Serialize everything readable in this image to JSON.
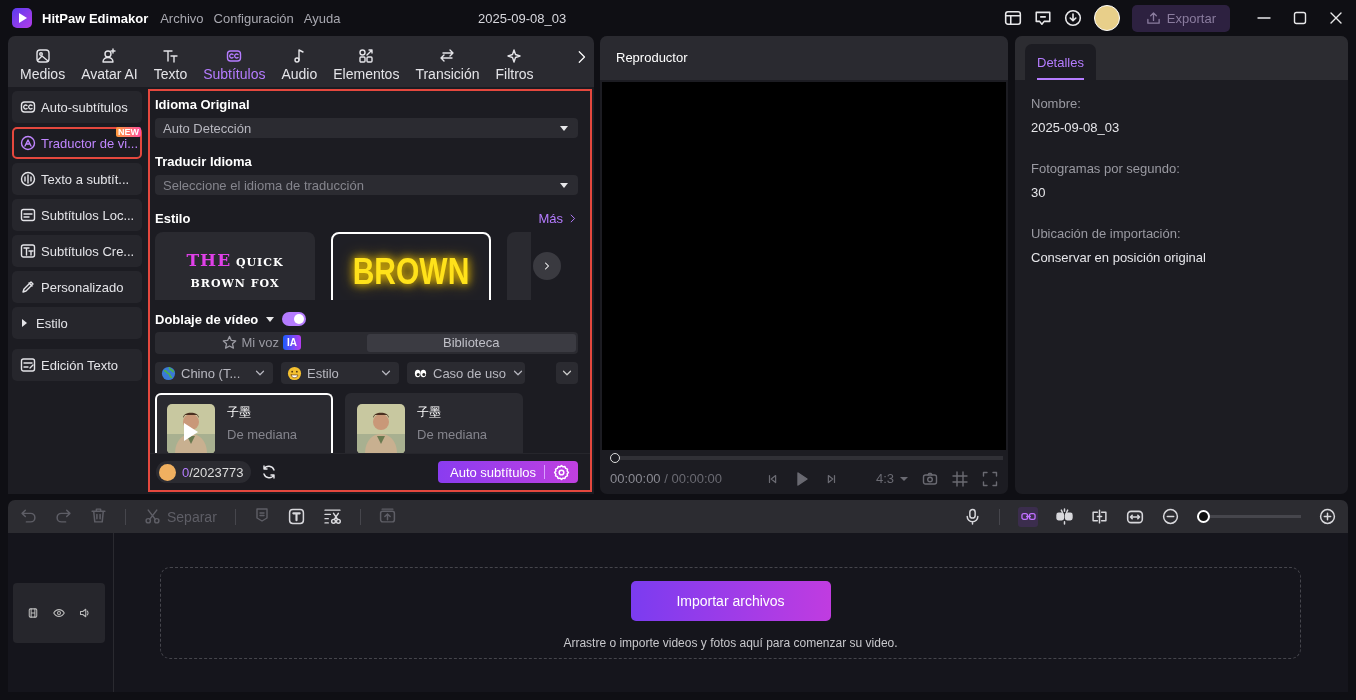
{
  "app": {
    "name": "HitPaw Edimakor",
    "menu": [
      "Archivo",
      "Configuración",
      "Ayuda"
    ],
    "document_title": "2025-09-08_03",
    "export_button": "Exportar"
  },
  "media_tabs": [
    {
      "label": "Medios",
      "selected": false
    },
    {
      "label": "Avatar AI",
      "selected": false
    },
    {
      "label": "Texto",
      "selected": false
    },
    {
      "label": "Subtítulos",
      "selected": true
    },
    {
      "label": "Audio",
      "selected": false
    },
    {
      "label": "Elementos",
      "selected": false
    },
    {
      "label": "Transición",
      "selected": false
    },
    {
      "label": "Filtros",
      "selected": false
    }
  ],
  "sidebar": {
    "items": [
      {
        "label": "Auto-subtítulos",
        "kind": "item",
        "selected": false
      },
      {
        "label": "Traductor de vi...",
        "kind": "item",
        "selected": true,
        "badge": "NEW"
      },
      {
        "label": "Texto a subtít...",
        "kind": "item",
        "selected": false
      },
      {
        "label": "Subtítulos Loc...",
        "kind": "item",
        "selected": false
      },
      {
        "label": "Subtítulos Cre...",
        "kind": "item",
        "selected": false
      },
      {
        "label": "Personalizado",
        "kind": "item",
        "selected": false
      },
      {
        "label": "Estilo",
        "kind": "group",
        "expanded": false,
        "selected": false
      },
      {
        "label": "Edición Texto",
        "kind": "item",
        "selected": false
      }
    ]
  },
  "translator": {
    "original_language": {
      "label": "Idioma Original",
      "value": "Auto Detección"
    },
    "translate_language": {
      "label": "Traducir Idioma",
      "placeholder": "Seleccione el idioma de traducción"
    },
    "style": {
      "label": "Estilo",
      "more_link": "Más",
      "presets": [
        {
          "kind": "classic",
          "highlight": "THE",
          "rest": "QUICK",
          "line2": "BROWN FOX",
          "selected": false
        },
        {
          "kind": "glow",
          "text": "BROWN",
          "selected": true
        },
        {
          "kind": "partial",
          "selected": false
        }
      ]
    },
    "dubbing": {
      "label": "Doblaje de vídeo",
      "on": true,
      "tabs": [
        {
          "label": "Mi voz",
          "badge": "IA",
          "selected": false
        },
        {
          "label": "Biblioteca",
          "selected": true
        }
      ],
      "filters": [
        {
          "label": "Chino (T..."
        },
        {
          "label": "Estilo"
        },
        {
          "label": "Caso de uso"
        }
      ],
      "voices": [
        {
          "name": "子墨",
          "description": "De mediana",
          "selected": true
        },
        {
          "name": "子墨",
          "description": "De mediana",
          "selected": false
        }
      ]
    },
    "credits": {
      "used": "0",
      "total": "/2023773"
    },
    "auto_subtitles_button": "Auto subtítulos"
  },
  "player": {
    "title": "Reproductor",
    "level": 0,
    "time_current": "00:00:00",
    "time_total": "/ 00:00:00",
    "aspect": "4:3"
  },
  "details": {
    "tab": "Detalles",
    "fields": [
      {
        "label": "Nombre:",
        "value": "2025-09-08_03"
      },
      {
        "label": "Fotogramas por segundo:",
        "value": "30"
      },
      {
        "label": "Ubicación de importación:",
        "value": "Conservar en posición original"
      }
    ]
  },
  "timeline": {
    "split_button": "Separar",
    "link_on": true,
    "zoom": {
      "level": 0
    },
    "import_button": "Importar archivos",
    "hint": "Arrastre o importe videos y fotos aquí para comenzar su video."
  }
}
